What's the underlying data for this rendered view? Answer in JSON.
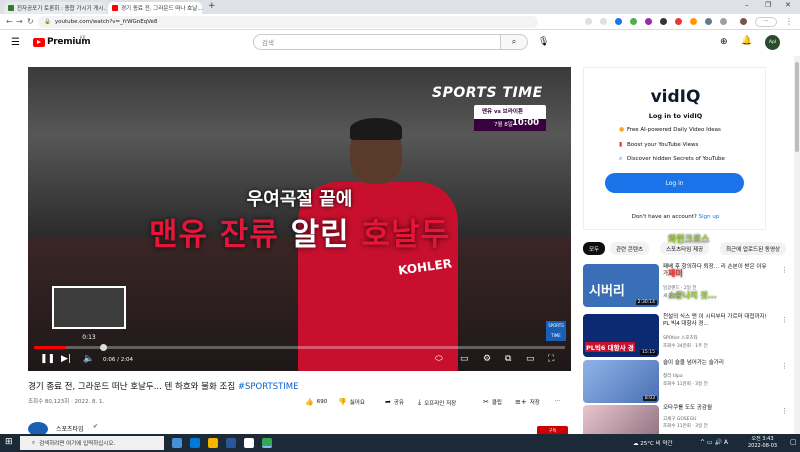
{
  "browser": {
    "tabs": [
      {
        "title": "전자공포기 토론회 : 종합 가시기 게시...",
        "active": false
      },
      {
        "title": "경기 종료 전, 그라운드 떠나 호날...",
        "active": true
      }
    ],
    "new_tab": "+",
    "url": "youtube.com/watch?v=_frWGnEqVe8"
  },
  "youtube": {
    "logo_text": "Premium",
    "region": "KR",
    "search_placeholder": "검색",
    "avatar_text": "Apl"
  },
  "video": {
    "brand": "SPORTS TIME",
    "brand_box_line1": "맨유 vs 브라이튼",
    "brand_box_date": "7월 8일",
    "brand_box_time": "10:00",
    "subtitle_line1": "우여곡절 끝에",
    "subtitle_line2_part1": "맨유 잔류",
    "subtitle_line2_part2": "알린",
    "subtitle_line2_part3": "호날두",
    "shirt_sponsor": "KOHLER",
    "preview_time": "0:13",
    "timecode": "0:06 / 2:04",
    "stamp": "SPORTS TIME",
    "progress_played_fraction": 0.06,
    "progress_hover_fraction": 0.13
  },
  "vidiq": {
    "logo": "vidIQ",
    "title": "Log in to vidIQ",
    "features": [
      {
        "icon": "dollar-icon",
        "text": "Free AI-powered Daily Video Ideas"
      },
      {
        "icon": "chart-icon",
        "text": "Boost your YouTube Views"
      },
      {
        "icon": "search-icon",
        "text": "Discover hidden Secrets of YouTube"
      }
    ],
    "login_button": "Log in",
    "no_account": "Don't have an account?",
    "signup": "Sign up"
  },
  "chips": [
    "모두",
    "관련 콘텐츠",
    "스포츠타임 제공",
    "최근에 업로드된 동영상"
  ],
  "recommendations": [
    {
      "title": "패배 후 항의하다 퇴장... 리 손본이 받은 이유가...",
      "meta1": "잉글랜드 · 2일 전",
      "meta2": "새 동영상",
      "duration": "2:30:14",
      "thumb_text": "시버리",
      "color": "#3a6fb8"
    },
    {
      "title": "천설의 식스 맨 이 시티부터 가르마 대접까지! PL 빅4 대항사 경...",
      "meta1": "SPOtier 스포츠타",
      "meta2": "조회수 34만회 · 1주 전",
      "duration": "15:15",
      "thumb_text": "PL빅6 대항사 경",
      "color": "#0b2a72"
    },
    {
      "title": "슬이 슬을 넘어가는 슬가리",
      "meta1": "청리 tilpa",
      "meta2": "조회수 11만회 · 3일 전",
      "duration": "8:03",
      "thumb_text": "",
      "color": "#5f86c9"
    },
    {
      "title": "오타쿠를 도도 공감월",
      "meta1": "고세구 GOSEGU",
      "meta2": "조회수 11만회 · 3일 전",
      "duration": "",
      "thumb_text": "",
      "color": "#b98c9a"
    }
  ],
  "overlays": {
    "top": "와힌크로스",
    "mid1": "재미",
    "mid2": "소문나지 것..."
  },
  "below": {
    "title": "경기 종료 전, 그라운드 떠난 호날두... 텐 하흐와 불화 조짐",
    "hashtag": "#SPORTSTIME",
    "meta": "조회수 80,123회 · 2022. 8. 1.",
    "likes": "690",
    "dislike": "싫어요",
    "share": "공유",
    "offline": "오프라인 저장",
    "clip": "클립",
    "save": "저장",
    "more": "···",
    "channel": "스포츠타임",
    "subscribe": "구독"
  },
  "taskbar": {
    "search": "검색하려면 여기에 입력하십시오.",
    "weather": "25°C 비 약간",
    "time": "오전 3:43",
    "date": "2022-08-03"
  }
}
